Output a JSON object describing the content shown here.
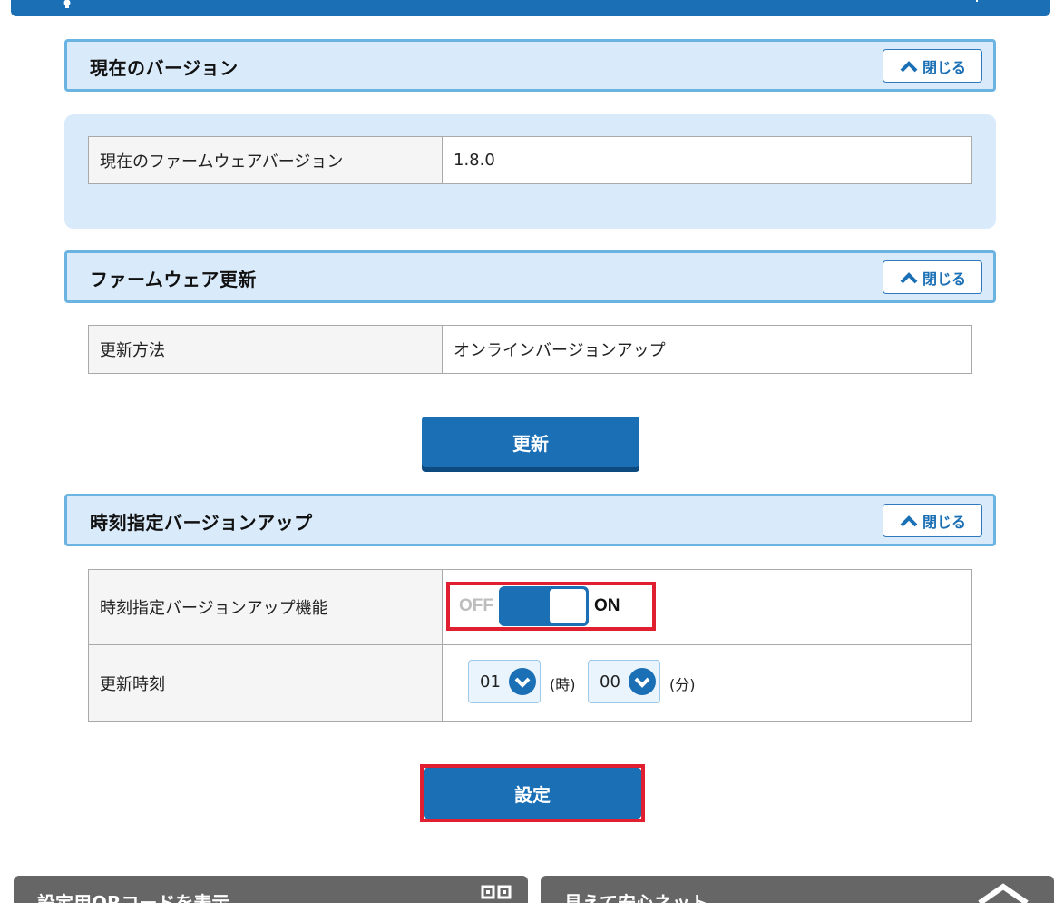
{
  "sections": {
    "current_version": {
      "title": "現在のバージョン",
      "close_label": "閉じる",
      "rows": [
        {
          "key": "現在のファームウェアバージョン",
          "value": "1.8.0"
        }
      ]
    },
    "firmware_update": {
      "title": "ファームウェア更新",
      "close_label": "閉じる",
      "rows": [
        {
          "key": "更新方法",
          "value": "オンラインバージョンアップ"
        }
      ],
      "button_label": "更新"
    },
    "scheduled_update": {
      "title": "時刻指定バージョンアップ",
      "close_label": "閉じる",
      "feature_label": "時刻指定バージョンアップ機能",
      "toggle": {
        "off_label": "OFF",
        "on_label": "ON",
        "state": "ON"
      },
      "time_label": "更新時刻",
      "hour": {
        "value": "01",
        "unit": "(時)"
      },
      "minute": {
        "value": "00",
        "unit": "(分)"
      },
      "button_label": "設定"
    }
  },
  "footer": {
    "left_tile": "設定用QRコードを表示",
    "right_tile": "見えて安心ネット"
  },
  "colors": {
    "primary": "#1a6fb5",
    "header_bg": "#d9ebfb",
    "header_border": "#6bb4e2",
    "highlight": "#e02030",
    "footer_bg": "#666666"
  }
}
